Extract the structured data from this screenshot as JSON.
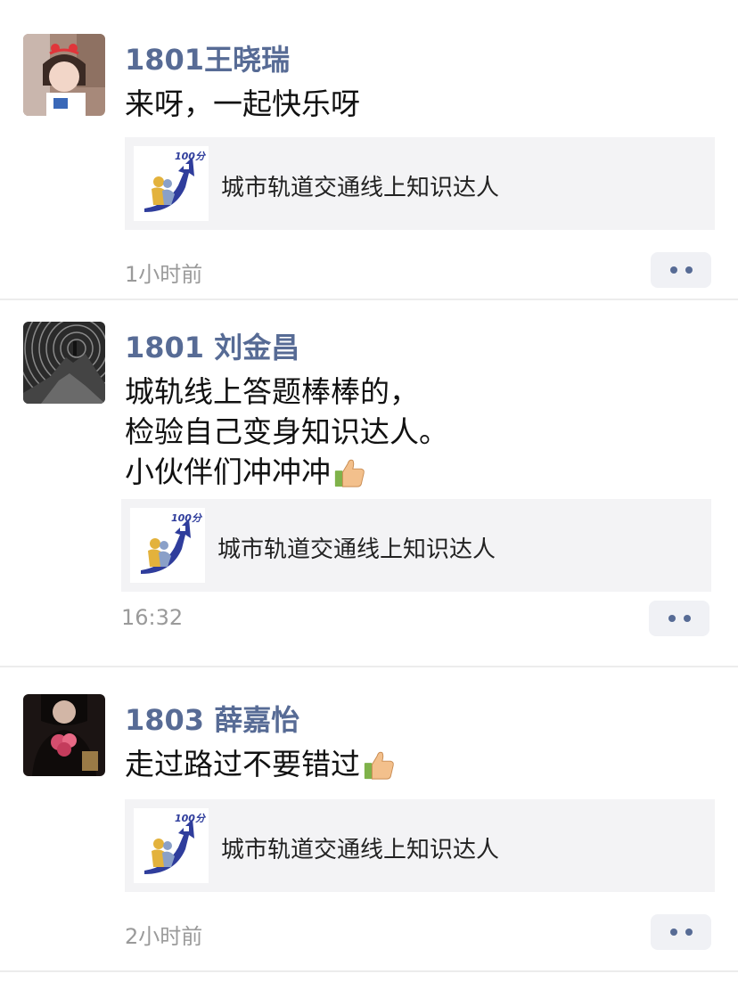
{
  "posts": [
    {
      "author": "1801王晓瑞",
      "avatar_icon": "girl-headband-avatar",
      "lines": [
        "来呀，一起快乐呀"
      ],
      "card": {
        "icon": "100-score-arrow-logo",
        "badge": "100分",
        "title": "城市轨道交通线上知识达人"
      },
      "time": "1小时前"
    },
    {
      "author": "1801 刘金昌",
      "avatar_icon": "mountain-rings-avatar",
      "lines": [
        "城轨线上答题棒棒的，",
        "检验自己变身知识达人。",
        "小伙伴们冲冲冲"
      ],
      "thumbs_up_on_line": 3,
      "card": {
        "icon": "100-score-arrow-logo",
        "badge": "100分",
        "title": "城市轨道交通线上知识达人"
      },
      "time": "16:32"
    },
    {
      "author": "1803 薛嘉怡",
      "avatar_icon": "dark-portrait-flowers-avatar",
      "lines": [
        "走过路过不要错过"
      ],
      "thumbs_up_on_line": 1,
      "card": {
        "icon": "100-score-arrow-logo",
        "badge": "100分",
        "title": "城市轨道交通线上知识达人"
      },
      "time": "2小时前"
    }
  ],
  "colors": {
    "author_name": "#576b95",
    "card_background": "#f3f3f5",
    "timestamp": "#9a9a9a",
    "logo_blue": "#2f3d9c"
  }
}
